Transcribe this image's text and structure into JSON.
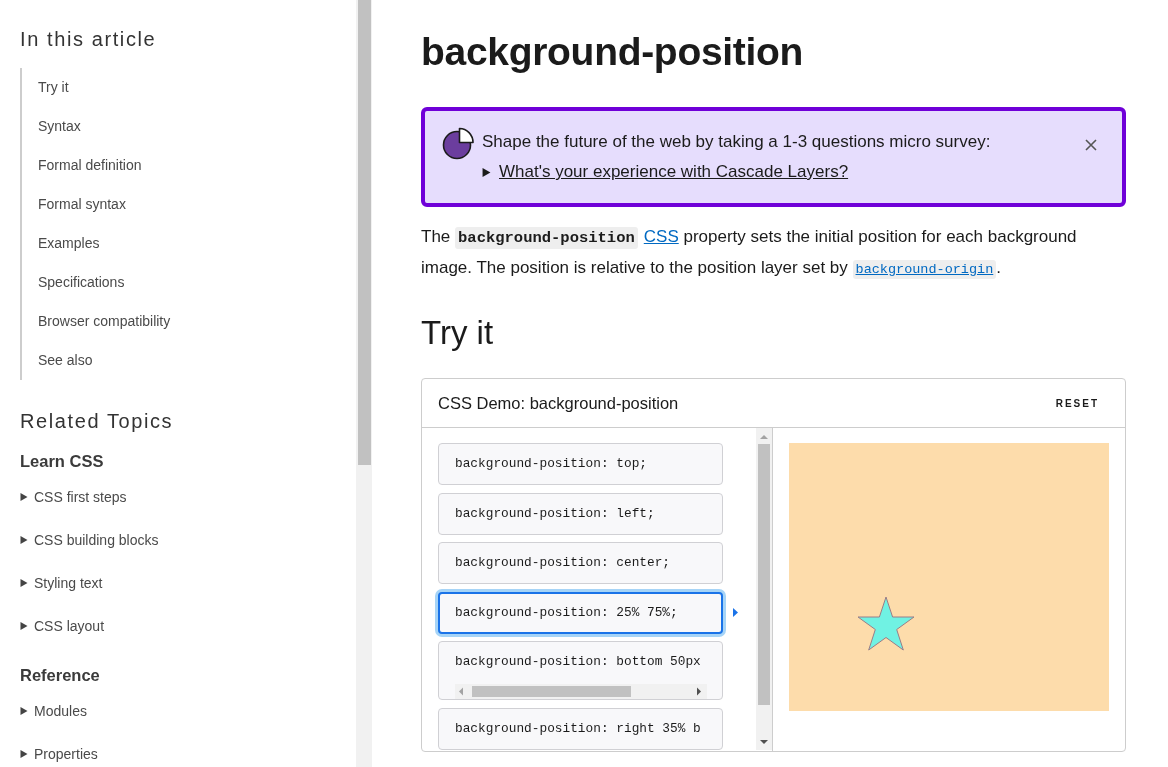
{
  "sidebar": {
    "toc_title": "In this article",
    "toc_items": [
      "Try it",
      "Syntax",
      "Formal definition",
      "Formal syntax",
      "Examples",
      "Specifications",
      "Browser compatibility",
      "See also"
    ],
    "related_title": "Related Topics",
    "sections": [
      {
        "heading": "Learn CSS",
        "items": [
          {
            "label": "CSS first steps",
            "expanded": false
          },
          {
            "label": "CSS building blocks",
            "expanded": false
          },
          {
            "label": "Styling text",
            "expanded": false
          },
          {
            "label": "CSS layout",
            "expanded": false
          }
        ]
      },
      {
        "heading": "Reference",
        "items": [
          {
            "label": "Modules",
            "expanded": false
          },
          {
            "label": "Properties",
            "expanded": false
          }
        ]
      }
    ]
  },
  "article": {
    "title": "background-position",
    "survey": {
      "text": "Shape the future of the web by taking a 1-3 questions micro survey:",
      "link": "What's your experience with Cascade Layers?",
      "expanded": false
    },
    "intro": [
      {
        "kind": "text",
        "text": "The "
      },
      {
        "kind": "code",
        "text": "background-position"
      },
      {
        "kind": "link",
        "text": "CSS"
      },
      {
        "kind": "text",
        "text": " property sets the initial position for each background image. The position is relative to the position layer set by "
      },
      {
        "kind": "code_link",
        "text": "background-origin"
      },
      {
        "kind": "text",
        "text": "."
      }
    ],
    "section_title": "Try it",
    "demo": {
      "title": "CSS Demo: background-position",
      "reset": "RESET",
      "choices": [
        {
          "code": "background-position: top;",
          "kind": "plain",
          "selected": false
        },
        {
          "code": "background-position: left;",
          "kind": "plain",
          "selected": false
        },
        {
          "code": "background-position: center;",
          "kind": "plain",
          "selected": false
        },
        {
          "code": "background-position: 25% 75%;",
          "kind": "plain",
          "selected": true
        },
        {
          "code": "background-position: bottom 50px",
          "kind": "scrolling",
          "selected": false
        },
        {
          "code": "background-position: right 35% b",
          "kind": "plain",
          "selected": false
        }
      ]
    }
  }
}
